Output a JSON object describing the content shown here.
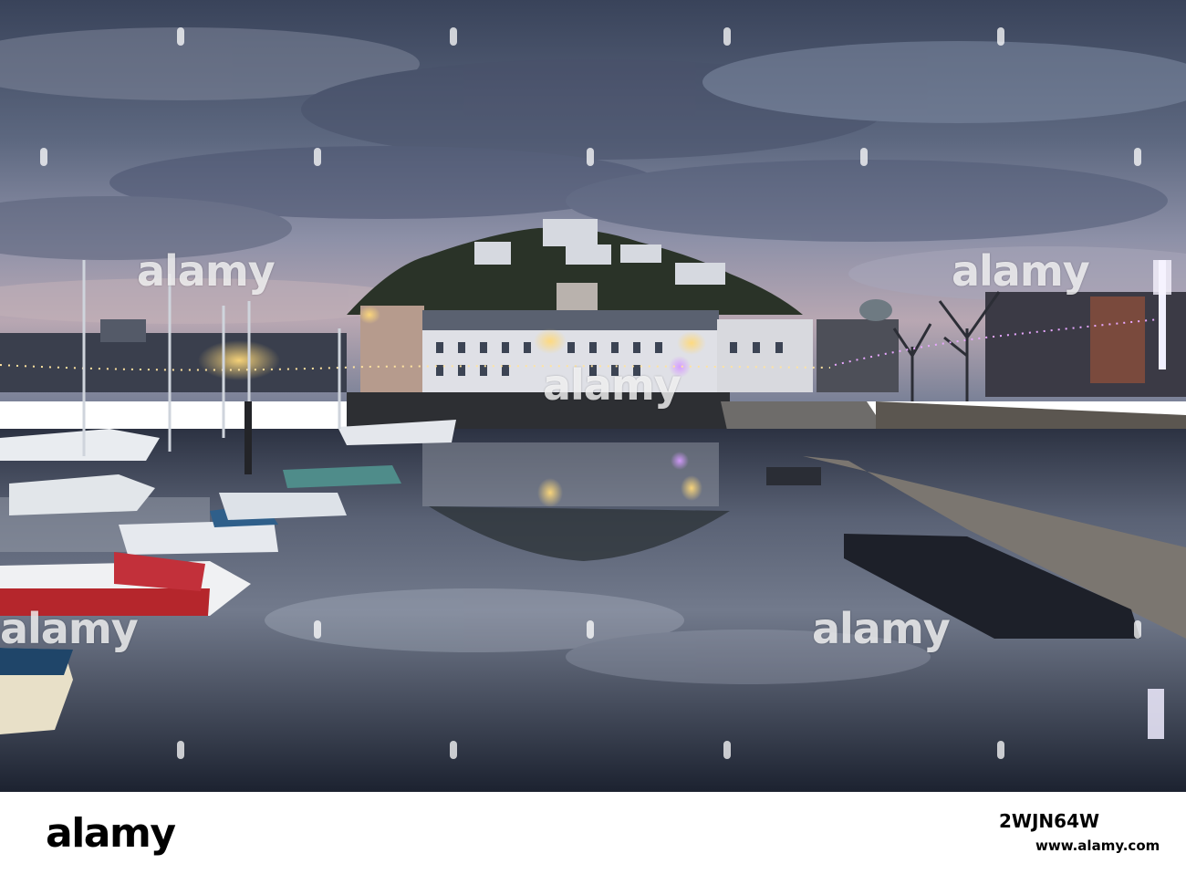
{
  "watermark": {
    "brand": "alamy"
  },
  "footer": {
    "logo": "alamy",
    "image_id": "2WJN64W",
    "url": "www.alamy.com"
  }
}
